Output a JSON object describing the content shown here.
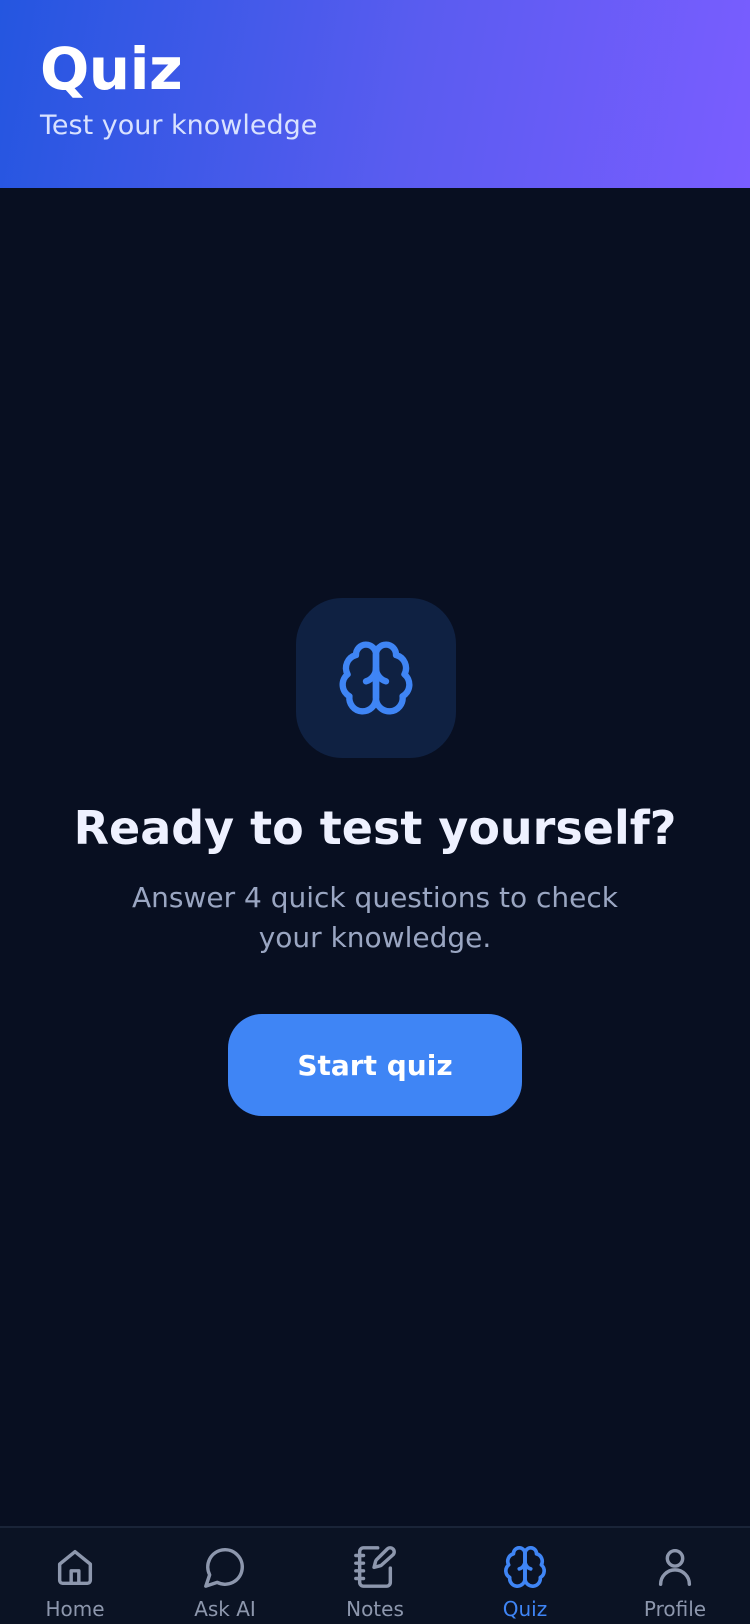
{
  "header": {
    "title": "Quiz",
    "subtitle": "Test your knowledge"
  },
  "hero": {
    "icon": "brain-icon",
    "title": "Ready to test yourself?",
    "description": "Answer 4 quick questions to check your knowledge.",
    "button_label": "Start quiz"
  },
  "nav": {
    "items": [
      {
        "label": "Home",
        "icon": "home-icon",
        "active": false
      },
      {
        "label": "Ask AI",
        "icon": "chat-bubble-icon",
        "active": false
      },
      {
        "label": "Notes",
        "icon": "notes-icon",
        "active": false
      },
      {
        "label": "Quiz",
        "icon": "brain-icon",
        "active": true
      },
      {
        "label": "Profile",
        "icon": "user-icon",
        "active": false
      }
    ]
  },
  "colors": {
    "background": "#080f21",
    "header_gradient_start": "#2456e0",
    "header_gradient_end": "#7a5dff",
    "accent": "#3f85f5",
    "nav_inactive": "#8d97ad",
    "icon_box": "#0f2142"
  }
}
